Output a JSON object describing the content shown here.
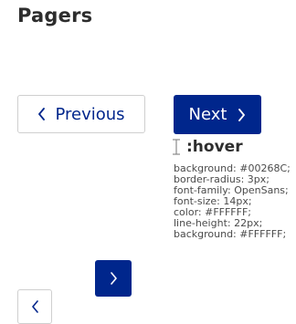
{
  "page": {
    "title": "Pagers"
  },
  "pager": {
    "previous_label": "Previous",
    "next_label": "Next"
  },
  "annotation": {
    "state_label": ":hover",
    "specs": [
      "background: #00268C;",
      "border-radius: 3px;",
      "font-family: OpenSans;",
      "font-size: 14px;",
      "color: #FFFFFF;",
      "line-height: 22px;",
      "background: #FFFFFF;"
    ]
  },
  "icons": {
    "previous": "chevron-left-icon",
    "next": "chevron-right-icon",
    "cursor": "text-cursor-icon"
  },
  "colors": {
    "primary": "#00268C",
    "on_primary": "#FFFFFF",
    "border": "#CFCFCF",
    "heading": "#2D2D2D"
  }
}
